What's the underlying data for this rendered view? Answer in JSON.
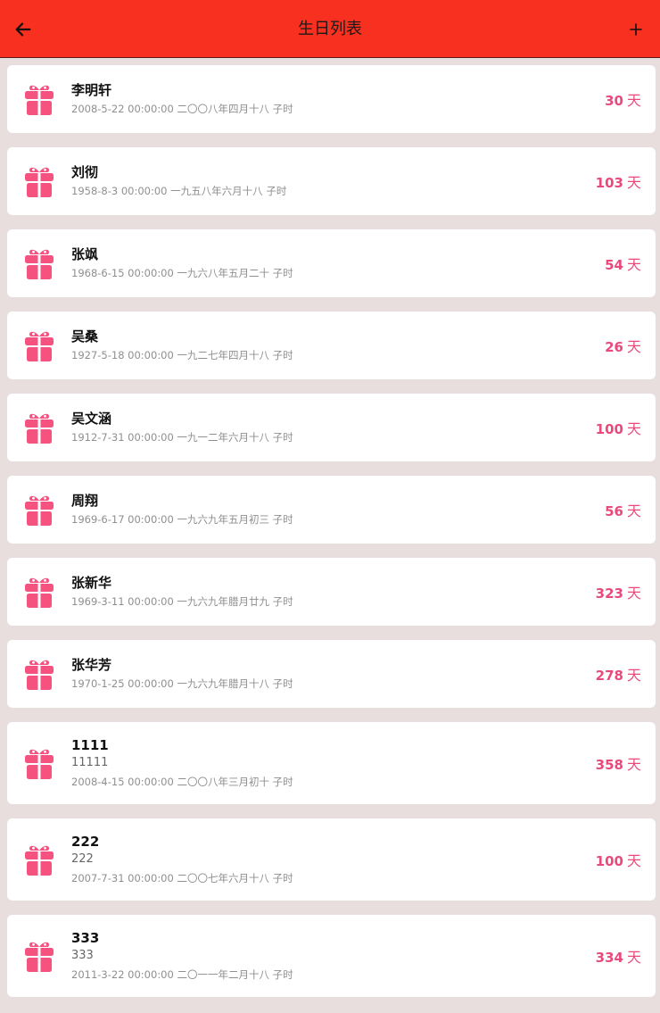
{
  "app_bar": {
    "title": "生日列表",
    "back_icon": "arrow-left-icon",
    "add_icon": "plus-icon",
    "background": "#f7301f"
  },
  "accent_color": "#e84a7c",
  "entries": [
    {
      "name": "李明轩",
      "note": "",
      "date": "2008-5-22 00:00:00 二〇〇八年四月十八 子时",
      "days": "30",
      "unit": "天"
    },
    {
      "name": "刘彻",
      "note": "",
      "date": "1958-8-3 00:00:00 一九五八年六月十八 子时",
      "days": "103",
      "unit": "天"
    },
    {
      "name": "张飒",
      "note": "",
      "date": "1968-6-15 00:00:00 一九六八年五月二十 子时",
      "days": "54",
      "unit": "天"
    },
    {
      "name": "吴桑",
      "note": "",
      "date": "1927-5-18 00:00:00 一九二七年四月十八 子时",
      "days": "26",
      "unit": "天"
    },
    {
      "name": "吴文涵",
      "note": "",
      "date": "1912-7-31 00:00:00 一九一二年六月十八 子时",
      "days": "100",
      "unit": "天"
    },
    {
      "name": "周翔",
      "note": "",
      "date": "1969-6-17 00:00:00 一九六九年五月初三 子时",
      "days": "56",
      "unit": "天"
    },
    {
      "name": "张新华",
      "note": "",
      "date": "1969-3-11 00:00:00 一九六九年腊月廿九 子时",
      "days": "323",
      "unit": "天"
    },
    {
      "name": "张华芳",
      "note": "",
      "date": "1970-1-25 00:00:00 一九六九年腊月十八 子时",
      "days": "278",
      "unit": "天"
    },
    {
      "name": "1111",
      "note": "11111",
      "date": "2008-4-15 00:00:00 二〇〇八年三月初十 子时",
      "days": "358",
      "unit": "天"
    },
    {
      "name": "222",
      "note": "222",
      "date": "2007-7-31 00:00:00 二〇〇七年六月十八 子时",
      "days": "100",
      "unit": "天"
    },
    {
      "name": "333",
      "note": "333",
      "date": "2011-3-22 00:00:00 二〇一一年二月十八 子时",
      "days": "334",
      "unit": "天"
    }
  ]
}
